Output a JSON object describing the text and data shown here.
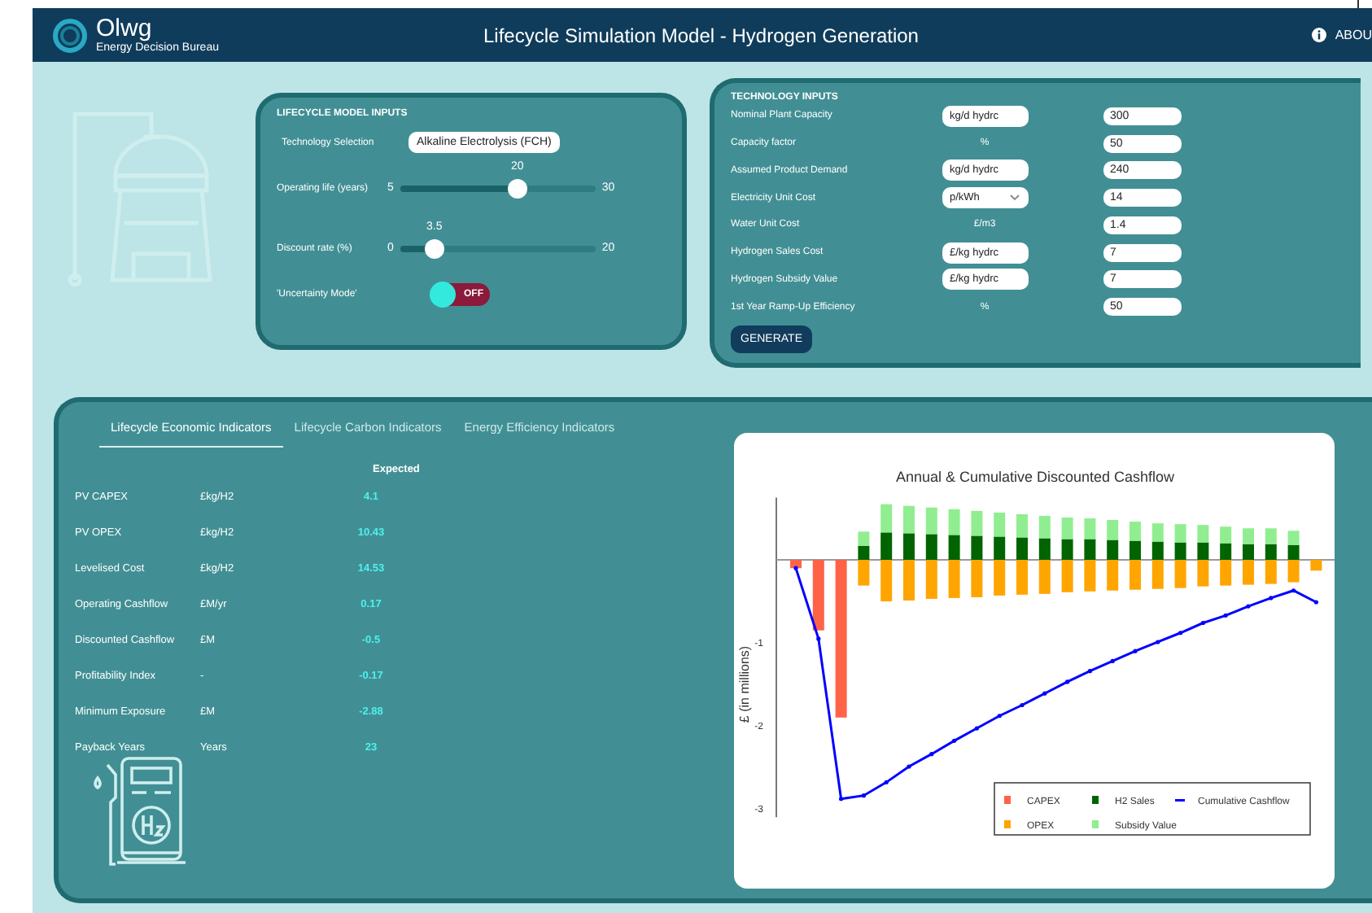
{
  "header": {
    "brand": "Olwg",
    "tagline": "Energy Decision Bureau",
    "title": "Lifecycle Simulation Model - Hydrogen Generation",
    "about": "ABOU"
  },
  "lifecycle_inputs": {
    "title": "LIFECYCLE MODEL INPUTS",
    "technology": {
      "label": "Technology Selection",
      "value": "Alkaline Electrolysis (FCH)"
    },
    "sliders": [
      {
        "label": "Operating life (years)",
        "min": "5",
        "max": "30",
        "reading": "20",
        "level": 0.6
      },
      {
        "label": "Discount rate (%)",
        "min": "0",
        "max": "20",
        "reading": "3.5",
        "level": 0.175
      }
    ],
    "uncertainty": {
      "label": "'Uncertainty Mode'",
      "state": "OFF",
      "on": false
    }
  },
  "technology_inputs": {
    "title": "TECHNOLOGY INPUTS",
    "rows": [
      {
        "label": "Nominal Plant Capacity",
        "kind": "input",
        "unit": "kg/d hydrc",
        "value": "300"
      },
      {
        "label": "Capacity factor",
        "kind": "text",
        "unit": "%",
        "value": "50"
      },
      {
        "label": "Assumed Product Demand",
        "kind": "input",
        "unit": "kg/d hydrc",
        "value": "240"
      },
      {
        "label": "Electricity Unit Cost",
        "kind": "select",
        "unit": "p/kWh",
        "value": "14"
      },
      {
        "label": "Water Unit Cost",
        "kind": "text",
        "unit": "£/m3",
        "value": "1.4"
      },
      {
        "label": "Hydrogen Sales Cost",
        "kind": "input",
        "unit": "£/kg hydrc",
        "value": "7"
      },
      {
        "label": "Hydrogen Subsidy Value",
        "kind": "input",
        "unit": "£/kg hydrc",
        "value": "7"
      },
      {
        "label": "1st Year Ramp-Up Efficiency",
        "kind": "text",
        "unit": "%",
        "value": "50"
      }
    ],
    "button": "GENERATE"
  },
  "tabs": [
    {
      "label": "Lifecycle Economic Indicators",
      "selected": true
    },
    {
      "label": "Lifecycle Carbon Indicators",
      "selected": false
    },
    {
      "label": "Energy Efficiency Indicators",
      "selected": false
    }
  ],
  "indicators": {
    "column": "Expected",
    "rows": [
      {
        "name": "PV CAPEX",
        "unit": "£kg/H2",
        "value": "4.1"
      },
      {
        "name": "PV OPEX",
        "unit": "£kg/H2",
        "value": "10.43"
      },
      {
        "name": "Levelised Cost",
        "unit": "£kg/H2",
        "value": "14.53"
      },
      {
        "name": "Operating Cashflow",
        "unit": "£M/yr",
        "value": "0.17"
      },
      {
        "name": "Discounted Cashflow",
        "unit": "£M",
        "value": "-0.5"
      },
      {
        "name": "Profitability Index",
        "unit": "-",
        "value": "-0.17"
      },
      {
        "name": "Minimum Exposure",
        "unit": "£M",
        "value": "-2.88"
      },
      {
        "name": "Payback Years",
        "unit": "Years",
        "value": "23"
      }
    ]
  },
  "chart": {
    "chart_data": {
      "type": "bar",
      "title": "Annual & Cumulative Discounted Cashflow",
      "ylabel": "£ (in millions)",
      "stacked": true,
      "legend": true,
      "ylim": [
        -3.1,
        0.75
      ],
      "yticks": [
        -3,
        -2,
        -1
      ],
      "series": [
        {
          "name": "CAPEX",
          "color": "#ff6347",
          "values": [
            -0.1,
            -0.85,
            -1.9,
            null,
            null,
            null,
            null,
            null,
            null,
            null,
            null,
            null,
            null,
            null,
            null,
            null,
            null,
            null,
            null,
            null,
            null,
            null,
            null,
            null
          ]
        },
        {
          "name": "H2 Sales",
          "color": "#006400",
          "values": [
            null,
            null,
            null,
            0.17,
            0.33,
            0.32,
            0.31,
            0.3,
            0.29,
            0.28,
            0.27,
            0.26,
            0.25,
            0.25,
            0.24,
            0.23,
            0.22,
            0.21,
            0.21,
            0.2,
            0.19,
            0.19,
            0.18,
            null
          ]
        },
        {
          "name": "Cumulative Cashflow",
          "color": "#0000ff",
          "type": "line",
          "values": [
            -0.1,
            -0.95,
            -2.88,
            -2.84,
            -2.68,
            -2.49,
            -2.34,
            -2.18,
            -2.03,
            -1.88,
            -1.75,
            -1.61,
            -1.47,
            -1.34,
            -1.22,
            -1.1,
            -0.99,
            -0.88,
            -0.76,
            -0.67,
            -0.56,
            -0.46,
            -0.37,
            -0.51
          ]
        },
        {
          "name": "OPEX",
          "color": "#ffa500",
          "values": [
            null,
            null,
            null,
            -0.31,
            -0.5,
            -0.49,
            -0.47,
            -0.46,
            -0.45,
            -0.43,
            -0.42,
            -0.41,
            -0.39,
            -0.38,
            -0.37,
            -0.36,
            -0.35,
            -0.34,
            -0.32,
            -0.31,
            -0.3,
            -0.29,
            -0.27,
            -0.13
          ]
        },
        {
          "name": "Subsidy Value",
          "color": "#90ee90",
          "values": [
            null,
            null,
            null,
            0.17,
            0.34,
            0.33,
            0.32,
            0.31,
            0.3,
            0.29,
            0.28,
            0.27,
            0.26,
            0.25,
            0.24,
            0.23,
            0.22,
            0.22,
            0.21,
            0.2,
            0.19,
            0.19,
            0.17,
            null
          ]
        }
      ]
    }
  }
}
